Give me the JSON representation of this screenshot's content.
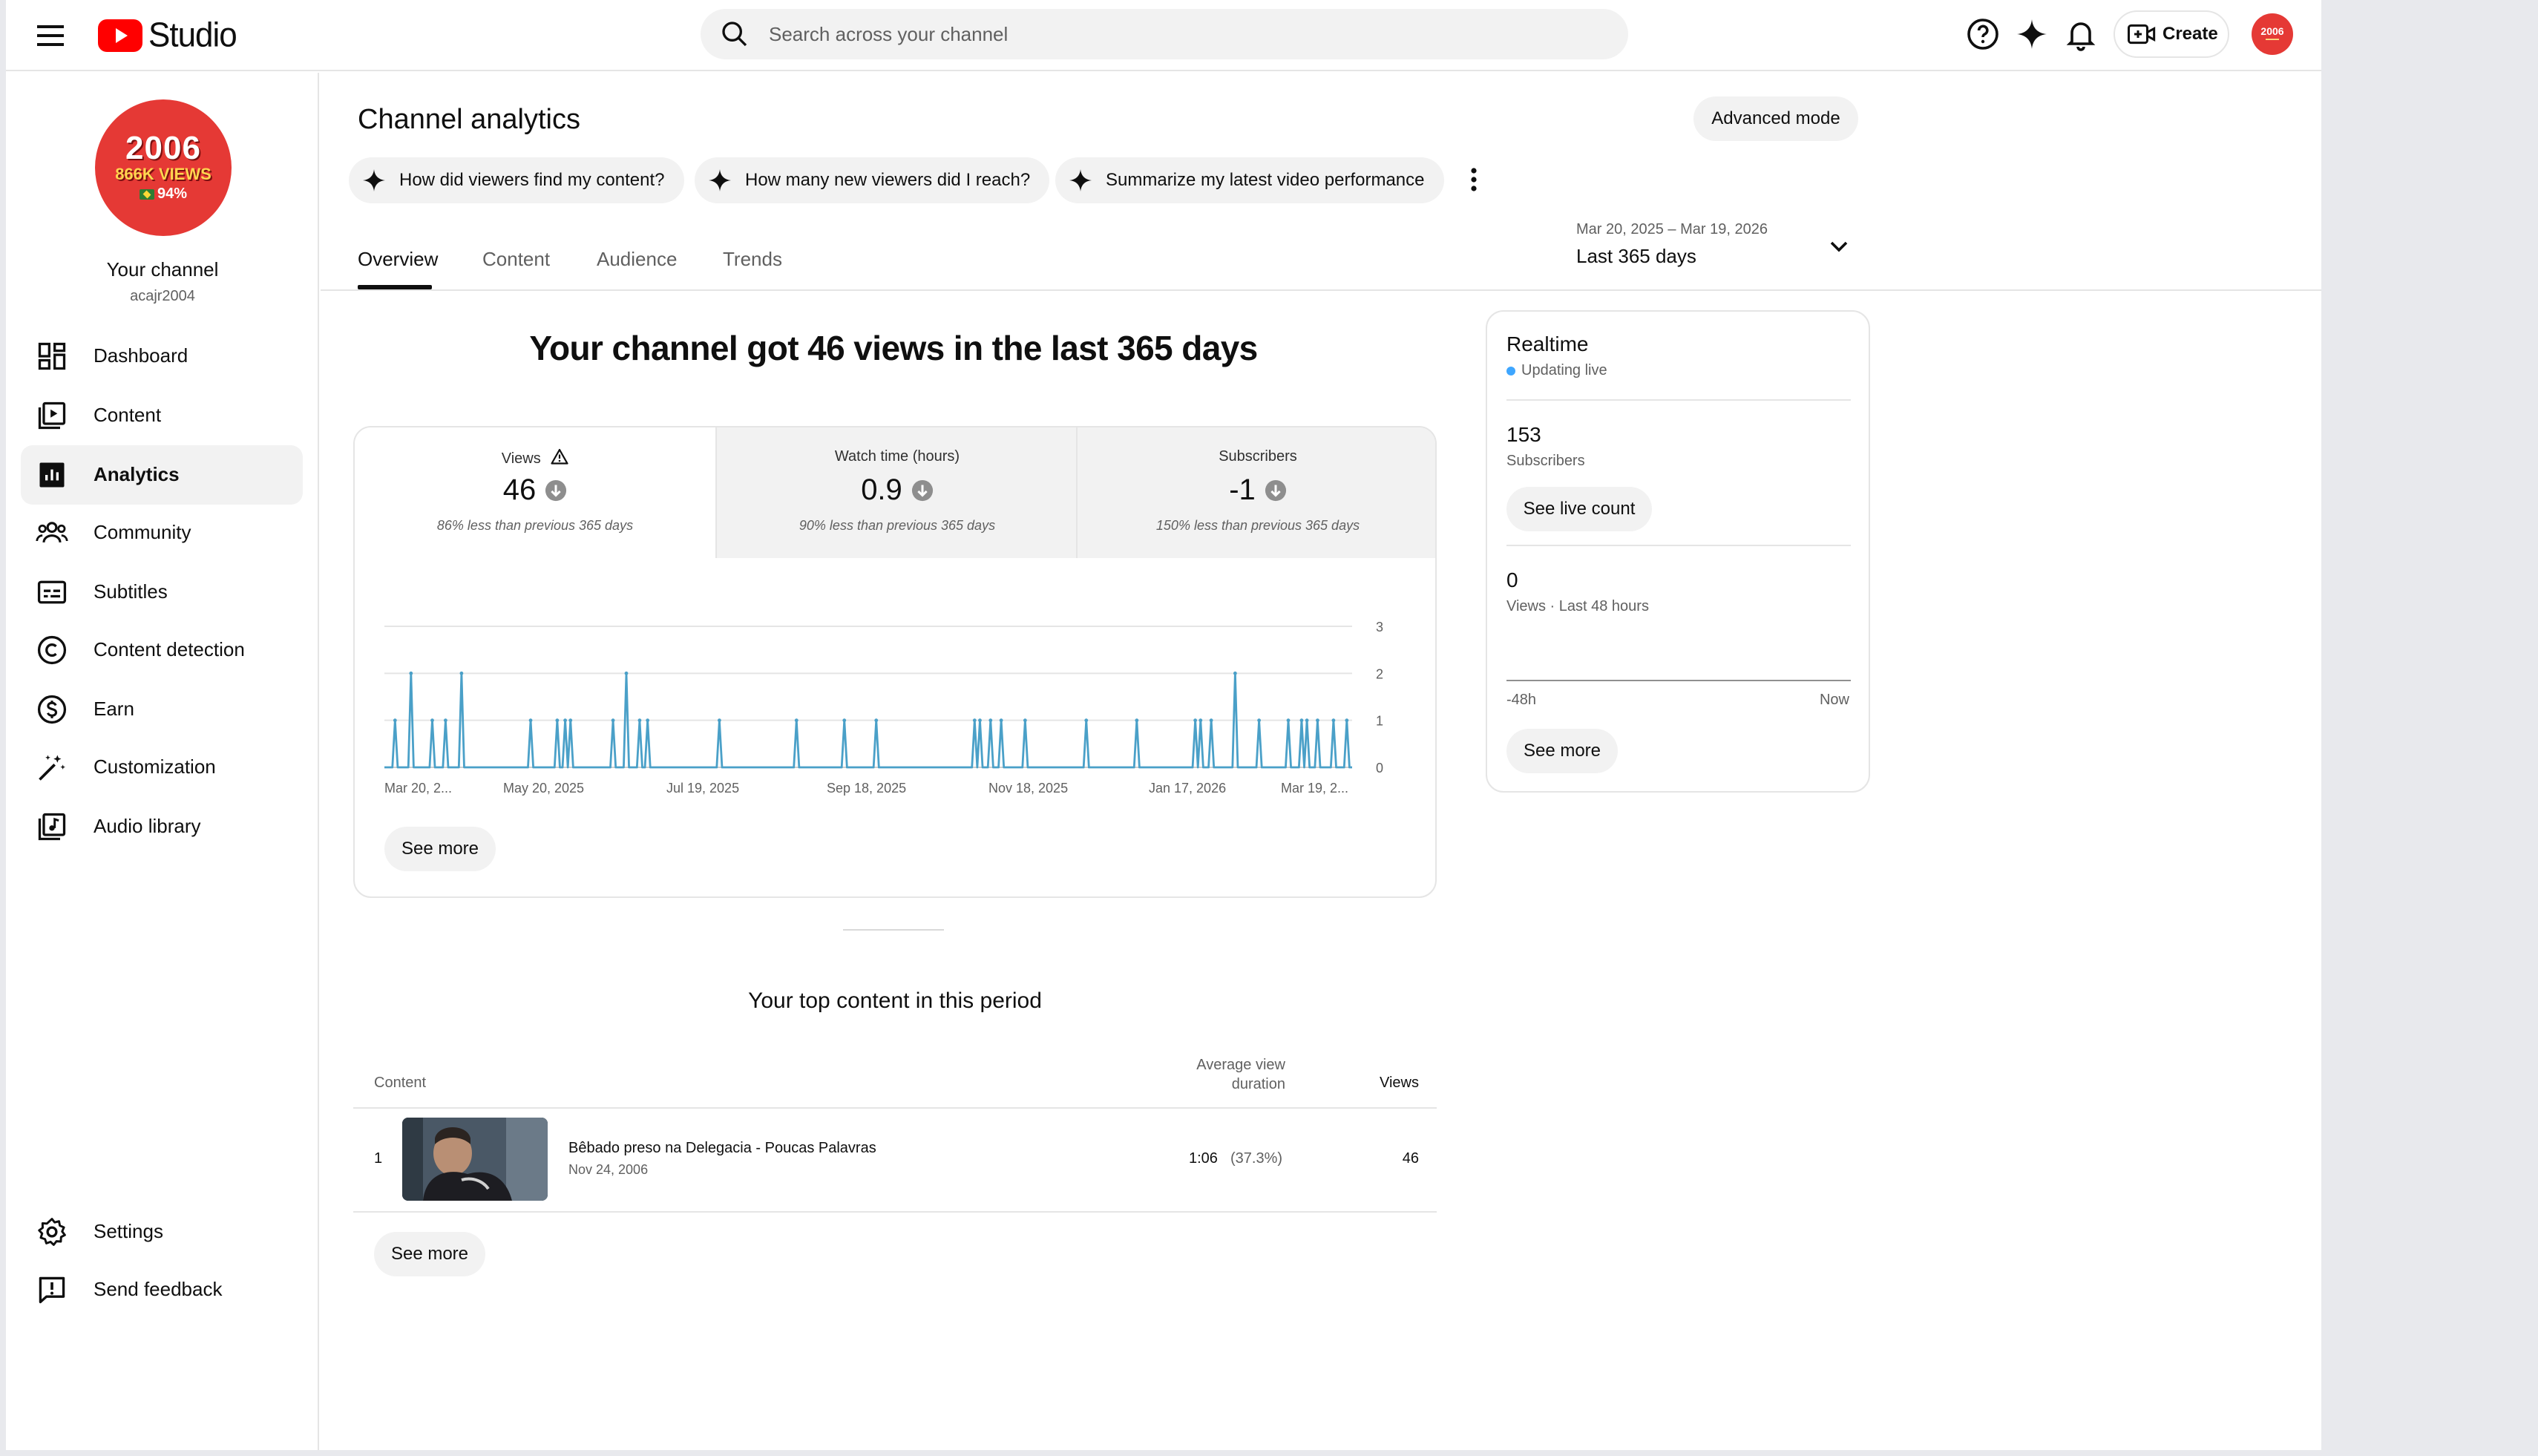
{
  "header": {
    "logo_text": "Studio",
    "search_placeholder": "Search across your channel",
    "create_label": "Create",
    "avatar_text": "2006"
  },
  "sidebar": {
    "avatar": {
      "line1": "2006",
      "line2": "866K VIEWS",
      "line3": "94%"
    },
    "channel_name": "Your channel",
    "channel_handle": "acajr2004",
    "items": [
      {
        "label": "Dashboard",
        "icon": "dashboard-icon"
      },
      {
        "label": "Content",
        "icon": "content-icon"
      },
      {
        "label": "Analytics",
        "icon": "analytics-icon",
        "active": true
      },
      {
        "label": "Community",
        "icon": "community-icon"
      },
      {
        "label": "Subtitles",
        "icon": "subtitles-icon"
      },
      {
        "label": "Content detection",
        "icon": "copyright-icon"
      },
      {
        "label": "Earn",
        "icon": "earn-icon"
      },
      {
        "label": "Customization",
        "icon": "customization-icon"
      },
      {
        "label": "Audio library",
        "icon": "audio-library-icon"
      }
    ],
    "bottom_items": [
      {
        "label": "Settings",
        "icon": "gear-icon"
      },
      {
        "label": "Send feedback",
        "icon": "feedback-icon"
      }
    ]
  },
  "main": {
    "title": "Channel analytics",
    "advanced_mode": "Advanced mode",
    "chips": [
      "How did viewers find my content?",
      "How many new viewers did I reach?",
      "Summarize my latest video performance"
    ],
    "tabs": [
      "Overview",
      "Content",
      "Audience",
      "Trends"
    ],
    "date_range": "Mar 20, 2025 – Mar 19, 2026",
    "date_label": "Last 365 days",
    "headline": "Your channel got 46 views in the last 365 days",
    "metrics": [
      {
        "label": "Views",
        "value": "46",
        "compare": "86% less than previous 365 days"
      },
      {
        "label": "Watch time (hours)",
        "value": "0.9",
        "compare": "90% less than previous 365 days"
      },
      {
        "label": "Subscribers",
        "value": "-1",
        "compare": "150% less than previous 365 days"
      }
    ],
    "chart_see_more": "See more",
    "top_content": {
      "title": "Your top content in this period",
      "col_content": "Content",
      "col_avd_1": "Average view",
      "col_avd_2": "duration",
      "col_views": "Views",
      "rows": [
        {
          "rank": "1",
          "title": "Bêbado preso na Delegacia - Poucas Palavras",
          "date": "Nov 24, 2006",
          "avd": "1:06",
          "avd_pct": "(37.3%)",
          "views": "46"
        }
      ],
      "see_more": "See more"
    }
  },
  "realtime": {
    "title": "Realtime",
    "status": "Updating live",
    "subscribers_value": "153",
    "subscribers_label": "Subscribers",
    "see_live_count": "See live count",
    "views_value": "0",
    "views_label": "Views · Last 48 hours",
    "axis_start": "-48h",
    "axis_end": "Now",
    "see_more": "See more"
  },
  "colors": {
    "accent_line": "#4aa0c8",
    "brand_red": "#ff0000",
    "avatar_red": "#e53935"
  },
  "chart_data": {
    "type": "line",
    "title": "",
    "xlabel": "",
    "ylabel": "Views",
    "ylim": [
      0,
      3
    ],
    "y_ticks": [
      "0",
      "1",
      "2",
      "3"
    ],
    "x_tick_labels": [
      "Mar 20, 2...",
      "May 20, 2025",
      "Jul 19, 2025",
      "Sep 18, 2025",
      "Nov 18, 2025",
      "Jan 17, 2026",
      "Mar 19, 2..."
    ],
    "spikes": [
      {
        "day": 4,
        "value": 1
      },
      {
        "day": 10,
        "value": 2
      },
      {
        "day": 18,
        "value": 1
      },
      {
        "day": 23,
        "value": 1
      },
      {
        "day": 29,
        "value": 2
      },
      {
        "day": 55,
        "value": 1
      },
      {
        "day": 65,
        "value": 1
      },
      {
        "day": 68,
        "value": 1
      },
      {
        "day": 70,
        "value": 1
      },
      {
        "day": 86,
        "value": 1
      },
      {
        "day": 91,
        "value": 2
      },
      {
        "day": 96,
        "value": 1
      },
      {
        "day": 99,
        "value": 1
      },
      {
        "day": 126,
        "value": 1
      },
      {
        "day": 155,
        "value": 1
      },
      {
        "day": 173,
        "value": 1
      },
      {
        "day": 185,
        "value": 1
      },
      {
        "day": 222,
        "value": 1
      },
      {
        "day": 224,
        "value": 1
      },
      {
        "day": 228,
        "value": 1
      },
      {
        "day": 232,
        "value": 1
      },
      {
        "day": 241,
        "value": 1
      },
      {
        "day": 264,
        "value": 1
      },
      {
        "day": 283,
        "value": 1
      },
      {
        "day": 305,
        "value": 1
      },
      {
        "day": 307,
        "value": 1
      },
      {
        "day": 311,
        "value": 1
      },
      {
        "day": 320,
        "value": 2
      },
      {
        "day": 329,
        "value": 1
      },
      {
        "day": 340,
        "value": 1
      },
      {
        "day": 345,
        "value": 1
      },
      {
        "day": 347,
        "value": 1
      },
      {
        "day": 351,
        "value": 1
      },
      {
        "day": 357,
        "value": 1
      },
      {
        "day": 362,
        "value": 1
      }
    ],
    "total_days": 365
  }
}
